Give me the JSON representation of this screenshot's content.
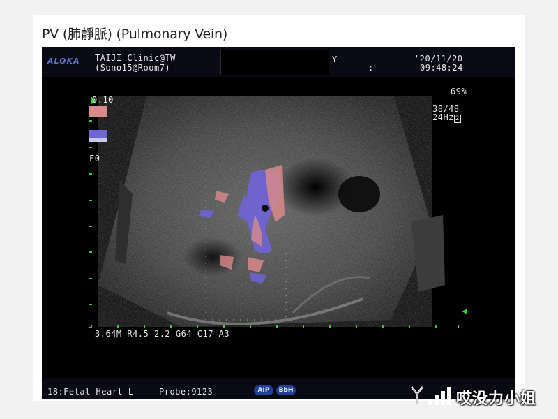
{
  "page": {
    "title": "PV (肺靜脈) (Pulmonary Vein)"
  },
  "header": {
    "logo": "ALOKA",
    "clinic": "TAIJI Clinic@TW",
    "room": "(Sono15@Room7)",
    "y_marker": "Y",
    "colon_marker": ":",
    "date": "'20/11/20",
    "time": "09:48:24"
  },
  "color_scale": {
    "top_value": "0.10",
    "focus_label": "F0"
  },
  "side_info": {
    "gain_percent": "69%",
    "depth_ratio": "38/48",
    "frame_rate": "24Hz",
    "frame_suffix": "2"
  },
  "params": "3.64M R4.5 2.2 G64 C17 A3",
  "footer": {
    "preset": "18:Fetal Heart L",
    "probe": "Probe:9123",
    "badges": [
      "AIP",
      "BbH"
    ]
  },
  "watermark": {
    "text": "哎没力小姐"
  },
  "colors": {
    "accent_blue": "#5a74c8",
    "scale_green": "#2fd12f",
    "doppler_red": "#d98a8a",
    "doppler_blue": "#6f64d8"
  }
}
